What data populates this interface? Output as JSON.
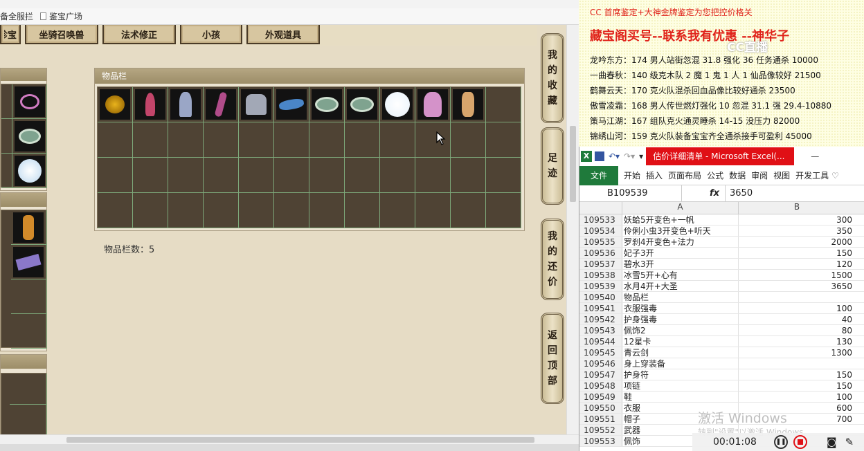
{
  "browser": {
    "bookmarks": [
      "备全服拦",
      "鉴宝广场"
    ]
  },
  "tabs": [
    "珍宝",
    "坐骑召唤兽",
    "法术修正",
    "小孩",
    "外观道具"
  ],
  "inventory": {
    "title": "物品栏",
    "count_label": "物品栏数：5",
    "rows": 4,
    "cols": 12,
    "items": [
      {
        "name": "gold-flower",
        "color": "#e8b31c"
      },
      {
        "name": "red-creature",
        "color": "#c2456a"
      },
      {
        "name": "ghost-figure",
        "color": "#9aa6c6"
      },
      {
        "name": "pink-tentacle",
        "color": "#b14c8a"
      },
      {
        "name": "grey-cloak",
        "color": "#a2a8b6"
      },
      {
        "name": "blue-dragon",
        "color": "#4a86c8"
      },
      {
        "name": "jade-ring",
        "color": "#7fa38f"
      },
      {
        "name": "jade-ring-2",
        "color": "#7fa38f"
      },
      {
        "name": "white-orb",
        "color": "#e8f2fb"
      },
      {
        "name": "pink-dress",
        "color": "#d492c9"
      },
      {
        "name": "flame-boot",
        "color": "#d7a56c"
      }
    ]
  },
  "sidebar": {
    "buttons": [
      {
        "label": "我的收藏",
        "chars": [
          "我",
          "的",
          "收",
          "藏"
        ]
      },
      {
        "label": "足迹",
        "chars": [
          "足",
          "迹"
        ]
      },
      {
        "label": "我的还价",
        "chars": [
          "我",
          "的",
          "还",
          "价"
        ]
      },
      {
        "label": "返回顶部",
        "chars": [
          "返",
          "回",
          "顶",
          "部"
        ]
      }
    ]
  },
  "info": {
    "line1": "CC 首席鉴定+大神金牌鉴定为您把控价格关",
    "line2": "藏宝阁买号--联系我有优惠 --神华子",
    "logo": "CC直播",
    "lines": [
      "龙吟东方：174 男人站街忽混 31.8 强化 36 任务通杀 10000",
      "一曲春秋：140 级克木队 2 魔 1 鬼 1 人 1 仙品像较好 21500",
      "鹤舞云天：170 克火队混杀回血品像比较好通杀 23500",
      "傲雪凌霜：168 男人传世燃灯强化 10 忽混 31.1 强 29.4-10880",
      "策马江湖：167 组队克火通灵睡杀 14-15 没压力 82000",
      "锦绣山河：159 克火队装备宝宝齐全通杀接手可盈利 45000"
    ]
  },
  "excel": {
    "title": "估价详细清单 - Microsoft Excel(...",
    "file_tab": "文件",
    "ribbon": [
      "开始",
      "插入",
      "页面布局",
      "公式",
      "数据",
      "审阅",
      "视图",
      "开发工具"
    ],
    "namebox": "B109539",
    "fx": "fx",
    "formula": "3650",
    "col_a": "A",
    "col_b": "B",
    "rows": [
      {
        "n": "109533",
        "a": "妖蛤5开变色+一帆",
        "b": "300"
      },
      {
        "n": "109534",
        "a": "伶俐小虫3开变色+听天",
        "b": "350"
      },
      {
        "n": "109535",
        "a": "罗刹4开变色+法力",
        "b": "2000"
      },
      {
        "n": "109536",
        "a": "妃子3开",
        "b": "150"
      },
      {
        "n": "109537",
        "a": "碧水3开",
        "b": "120"
      },
      {
        "n": "109538",
        "a": "冰雪5开+心有",
        "b": "1500"
      },
      {
        "n": "109539",
        "a": "水月4开+大圣",
        "b": "3650"
      },
      {
        "n": "109540",
        "a": "物品栏",
        "b": ""
      },
      {
        "n": "109541",
        "a": "衣服强毒",
        "b": "100"
      },
      {
        "n": "109542",
        "a": "护身强毒",
        "b": "40"
      },
      {
        "n": "109543",
        "a": "佩饰2",
        "b": "80"
      },
      {
        "n": "109544",
        "a": "12星卡",
        "b": "130"
      },
      {
        "n": "109545",
        "a": "青云剑",
        "b": "1300"
      },
      {
        "n": "109546",
        "a": "身上穿装备",
        "b": ""
      },
      {
        "n": "109547",
        "a": "护身符",
        "b": "150"
      },
      {
        "n": "109548",
        "a": "项链",
        "b": "150"
      },
      {
        "n": "109549",
        "a": "鞋",
        "b": "100"
      },
      {
        "n": "109550",
        "a": "衣服",
        "b": "600"
      },
      {
        "n": "109551",
        "a": "帽子",
        "b": "700"
      },
      {
        "n": "109552",
        "a": "武器",
        "b": ""
      },
      {
        "n": "109553",
        "a": "佩饰",
        "b": ""
      }
    ]
  },
  "watermark": {
    "line1": "激活 Windows",
    "line2": "转到\"设置\"以激活 Windows。"
  },
  "recorder": {
    "time": "00:01:08"
  }
}
